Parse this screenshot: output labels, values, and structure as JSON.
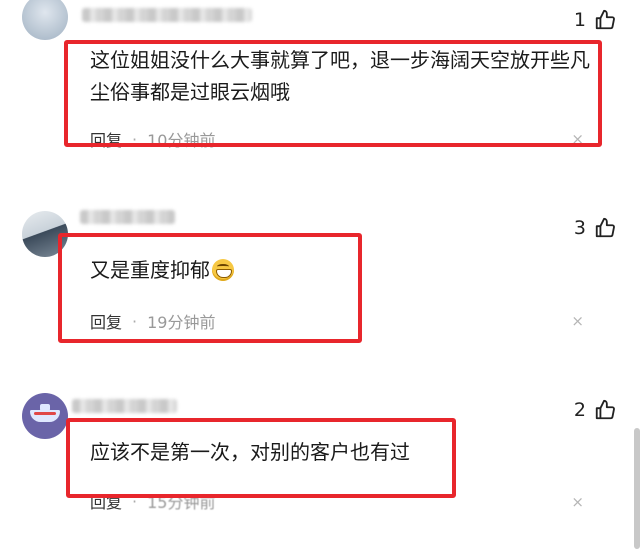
{
  "comments": [
    {
      "likes": "1",
      "text": "这位姐姐没什么大事就算了吧，退一步海阔天空放开些凡尘俗事都是过眼云烟哦",
      "reply_label": "回复",
      "separator": "·",
      "time": "10分钟前",
      "close_glyph": "×"
    },
    {
      "likes": "3",
      "text": "又是重度抑郁",
      "emoji": "grinning-face-emoji",
      "reply_label": "回复",
      "separator": "·",
      "time": "19分钟前",
      "close_glyph": "×"
    },
    {
      "likes": "2",
      "text": "应该不是第一次，对别的客户也有过",
      "reply_label": "回复",
      "separator": "·",
      "time": "15分钟前",
      "close_glyph": "×"
    }
  ],
  "icons": {
    "like": "thumbs-up-icon",
    "close": "close-icon"
  },
  "colors": {
    "highlight": "#e8262c",
    "meta_text": "#999999"
  }
}
